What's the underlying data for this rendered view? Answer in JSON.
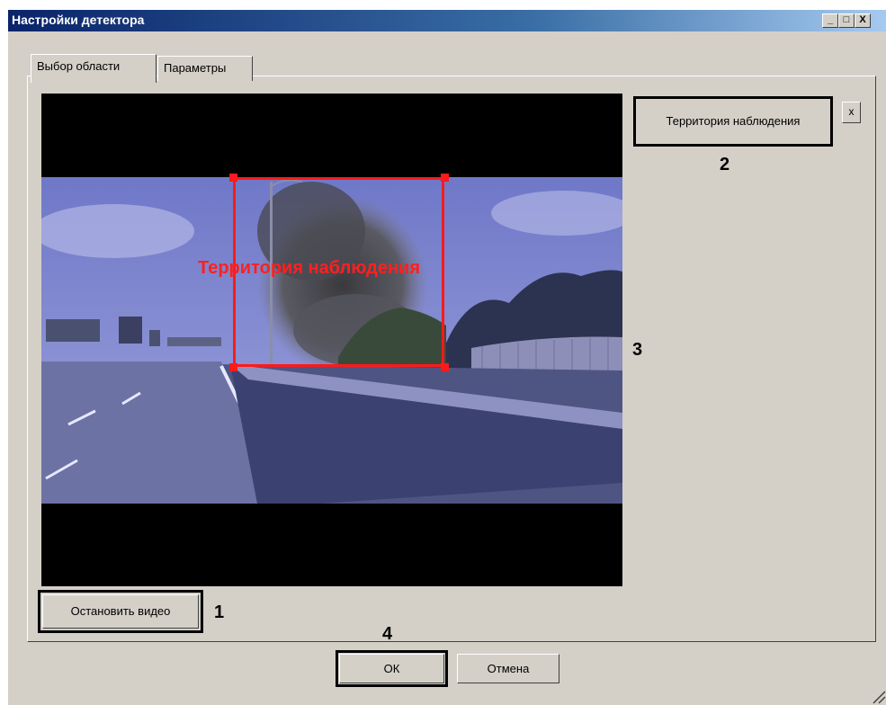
{
  "window": {
    "title": "Настройки детектора",
    "controls": {
      "minimize": "_",
      "maximize": "□",
      "close": "X"
    }
  },
  "tabs": [
    {
      "label": "Выбор области",
      "active": true
    },
    {
      "label": "Параметры",
      "active": false
    }
  ],
  "preview": {
    "area_label": "Территория наблюдения"
  },
  "zones": {
    "items": [
      {
        "label": "Территория наблюдения"
      }
    ],
    "remove_label": "x"
  },
  "buttons": {
    "stop_video": "Остановить видео",
    "ok": "ОК",
    "cancel": "Отмена"
  },
  "callouts": [
    "1",
    "2",
    "3",
    "4"
  ],
  "colors": {
    "title_start": "#0a246a",
    "title_end": "#a6caf0",
    "face": "#d4d0c8",
    "area_outline": "#ff1a1a"
  }
}
